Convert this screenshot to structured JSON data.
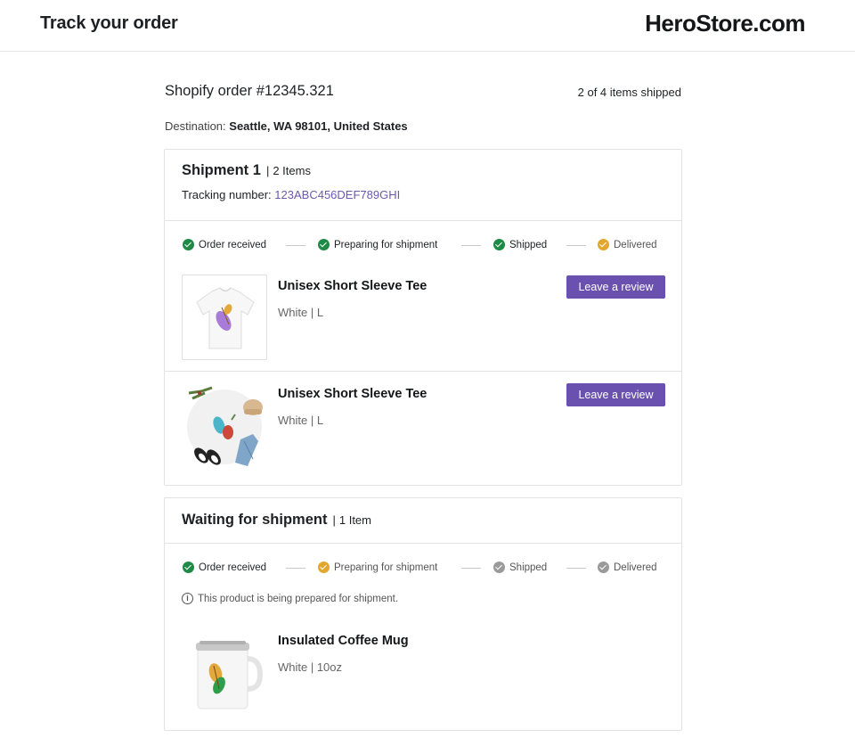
{
  "header": {
    "title": "Track your order",
    "brand": "HeroStore.com"
  },
  "order": {
    "title": "Shopify order #12345.321",
    "shipped_count": "2 of 4 items shipped",
    "destination_label": "Destination:",
    "destination_value": "Seattle, WA 98101, United States"
  },
  "colors": {
    "done": "#1e8a45",
    "current": "#e2a72e",
    "pending": "#9a9a9a",
    "accent": "#6a51b0"
  },
  "shipment1": {
    "title": "Shipment 1",
    "sep": "|",
    "count": "2 Items",
    "tracking_label": "Tracking number:",
    "tracking_number": "123ABC456DEF789GHI",
    "steps": [
      {
        "label": "Order received",
        "status": "done"
      },
      {
        "label": "Preparing for shipment",
        "status": "done"
      },
      {
        "label": "Shipped",
        "status": "done"
      },
      {
        "label": "Delivered",
        "status": "current"
      }
    ],
    "items": [
      {
        "name": "Unisex Short Sleeve Tee",
        "variant": "White | L",
        "button": "Leave a review"
      },
      {
        "name": "Unisex Short Sleeve Tee",
        "variant": "White | L",
        "button": "Leave a review"
      }
    ]
  },
  "shipment2": {
    "title": "Waiting for shipment",
    "sep": "|",
    "count": "1 Item",
    "steps": [
      {
        "label": "Order received",
        "status": "done"
      },
      {
        "label": "Preparing for shipment",
        "status": "current"
      },
      {
        "label": "Shipped",
        "status": "pending"
      },
      {
        "label": "Delivered",
        "status": "pending"
      }
    ],
    "notice_icon": "i",
    "notice": "This product is being prepared for shipment.",
    "items": [
      {
        "name": "Insulated Coffee Mug",
        "variant": "White | 10oz"
      }
    ]
  }
}
